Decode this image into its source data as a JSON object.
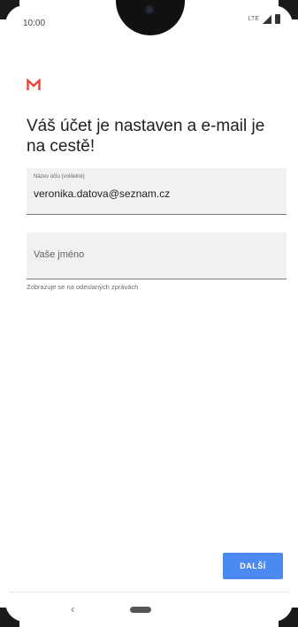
{
  "status_bar": {
    "time": "10:00",
    "network": "LTE",
    "icons": [
      "camera-icon",
      "lte-icon",
      "signal-icon",
      "battery-icon"
    ]
  },
  "app": {
    "logo_icon": "gmail-icon",
    "brand_color": "#ea4335"
  },
  "screen": {
    "headline": "Váš účet je nastaven a e-mail je na cestě!",
    "account_field": {
      "label": "Název účtu (volitelné)",
      "value": "veronika.datova@seznam.cz"
    },
    "name_field": {
      "placeholder": "Vaše jméno",
      "helper": "Zobrazuje se na odeslaných zprávách"
    },
    "next_button": {
      "label": "DALŠÍ",
      "color": "#4a8af0"
    }
  },
  "nav_bar": {
    "back_icon": "back-icon",
    "back_glyph": "‹",
    "home_icon": "home-pill-icon"
  }
}
